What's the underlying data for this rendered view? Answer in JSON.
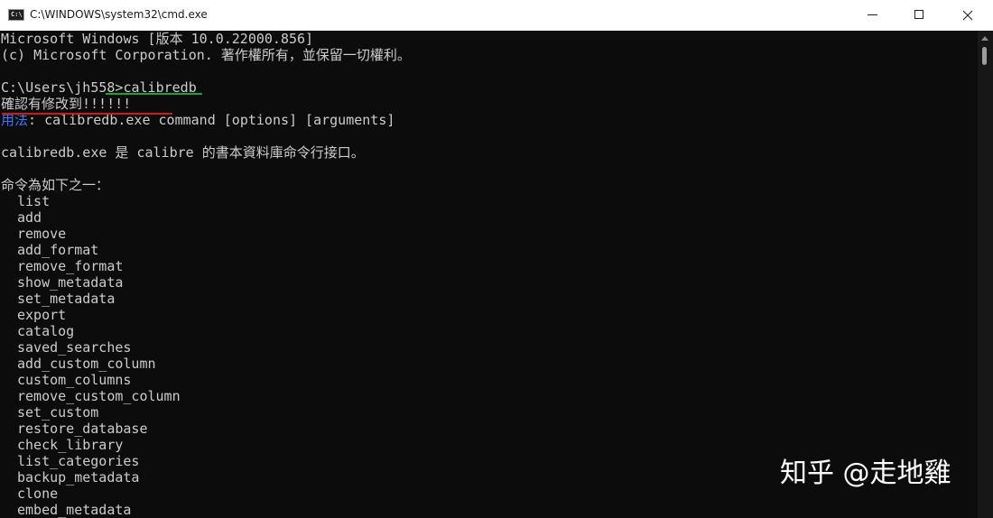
{
  "window": {
    "title": "C:\\WINDOWS\\system32\\cmd.exe",
    "icon_name": "cmd-icon",
    "icon_text": "C:\\"
  },
  "console": {
    "lines": [
      "Microsoft Windows [版本 10.0.22000.856]",
      "(c) Microsoft Corporation. 著作權所有，並保留一切權利。",
      "",
      "C:\\Users\\jh558>calibredb",
      "確認有修改到!!!!!!",
      "",
      "",
      "calibredb.exe 是 calibre 的書本資料庫命令行接口。",
      "",
      "命令為如下之一："
    ],
    "usage": {
      "label": "用法",
      "rest": ": calibredb.exe command [options] [arguments]"
    },
    "commands": [
      "list",
      "add",
      "remove",
      "add_format",
      "remove_format",
      "show_metadata",
      "set_metadata",
      "export",
      "catalog",
      "saved_searches",
      "add_custom_column",
      "custom_columns",
      "remove_custom_column",
      "set_custom",
      "restore_database",
      "check_library",
      "list_categories",
      "backup_metadata",
      "clone",
      "embed_metadata"
    ]
  },
  "annotations": {
    "green": "#18a832",
    "red": "#d01818"
  },
  "watermark": "知乎 @走地雞"
}
